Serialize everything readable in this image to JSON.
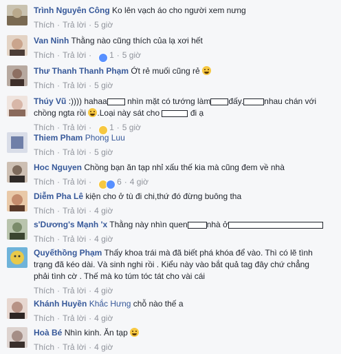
{
  "comments": [
    {
      "author": "Trình Nguyên Công",
      "text": "Ko lên vạch áo cho người xem nưng",
      "like": "Thích",
      "reply": "Trả lời",
      "time": "5 giờ",
      "avatar_color": "#b9a98c"
    },
    {
      "author": "Van Ninh",
      "text": "Thằng nào cũng thích của lạ xơi hết",
      "like": "Thích",
      "reply": "Trả lời",
      "reaction_count": "1",
      "time": "5 giờ",
      "avatar_color": "#caa58d"
    },
    {
      "author": "Thư Thanh Thanh Phạm",
      "text": "Ớt rẻ muối cũng rẻ",
      "like": "Thích",
      "reply": "Trả lời",
      "time": "5 giờ",
      "avatar_color": "#8d6f62"
    },
    {
      "author": "Thúy Vũ",
      "text_parts": [
        ":))))  hahaa",
        "nhìn mặt có tướng làm",
        "đấy.",
        "nhau chán với chồng ngta rồi",
        ".Loại này sát cho",
        "đi ạ"
      ],
      "like": "Thích",
      "reply": "Trả lời",
      "reaction_count": "1",
      "time": "5 giờ",
      "avatar_color": "#d8b7a8"
    },
    {
      "author": "Thiem Pham",
      "mention": "Phong Luu",
      "like": "Thích",
      "reply": "Trả lời",
      "time": "5 giờ",
      "avatar_color": "#6f7fa8"
    },
    {
      "author": "Hoc Nguyen",
      "text": "Chồng bạn ăn tạp nhỉ xấu thế kia mà cũng đem về nhà",
      "like": "Thích",
      "reply": "Trả lời",
      "reaction_count": "6",
      "time": "4 giờ",
      "avatar_color": "#7d6a5c"
    },
    {
      "author": "Diễm Pha Lê",
      "text": "kiện cho ở tù đi chi,thứ đó đừng buông tha",
      "like": "Thích",
      "reply": "Trả lời",
      "time": "4 giờ",
      "avatar_color": "#c48c6d"
    },
    {
      "author": "s'Dương's Mạnh 'x",
      "text_parts": [
        "Thằng này nhìn quen",
        "nhà ở"
      ],
      "like": "Thích",
      "reply": "Trả lời",
      "time": "4 giờ",
      "avatar_color": "#7a8b6a"
    },
    {
      "author": "Quyếthồng Phạm",
      "text": "Thấy khoa trái mà đã biết phá khóa để vào. Thì có lẽ tình trạng đã kéo dài. Và sinh nghi rồi . Kiểu này vào bắt quả tag đây chứ chẳng phải tình cờ . Thế mà ko túm tóc tát cho vài cái",
      "like": "Thích",
      "reply": "Trả lời",
      "time": "4 giờ",
      "avatar_color": "#e8c94a"
    },
    {
      "author": "Khánh Huyền",
      "mention": "Khắc Hưng",
      "text": "chỗ nào thế a",
      "like": "Thích",
      "reply": "Trả lời",
      "time": "4 giờ",
      "avatar_color": "#b79386"
    },
    {
      "author": "Hoà Bé",
      "text": "Nhìn kinh. Ăn tạp",
      "like": "Thích",
      "reply": "Trả lời",
      "time": "4 giờ",
      "avatar_color": "#a58e86"
    }
  ]
}
